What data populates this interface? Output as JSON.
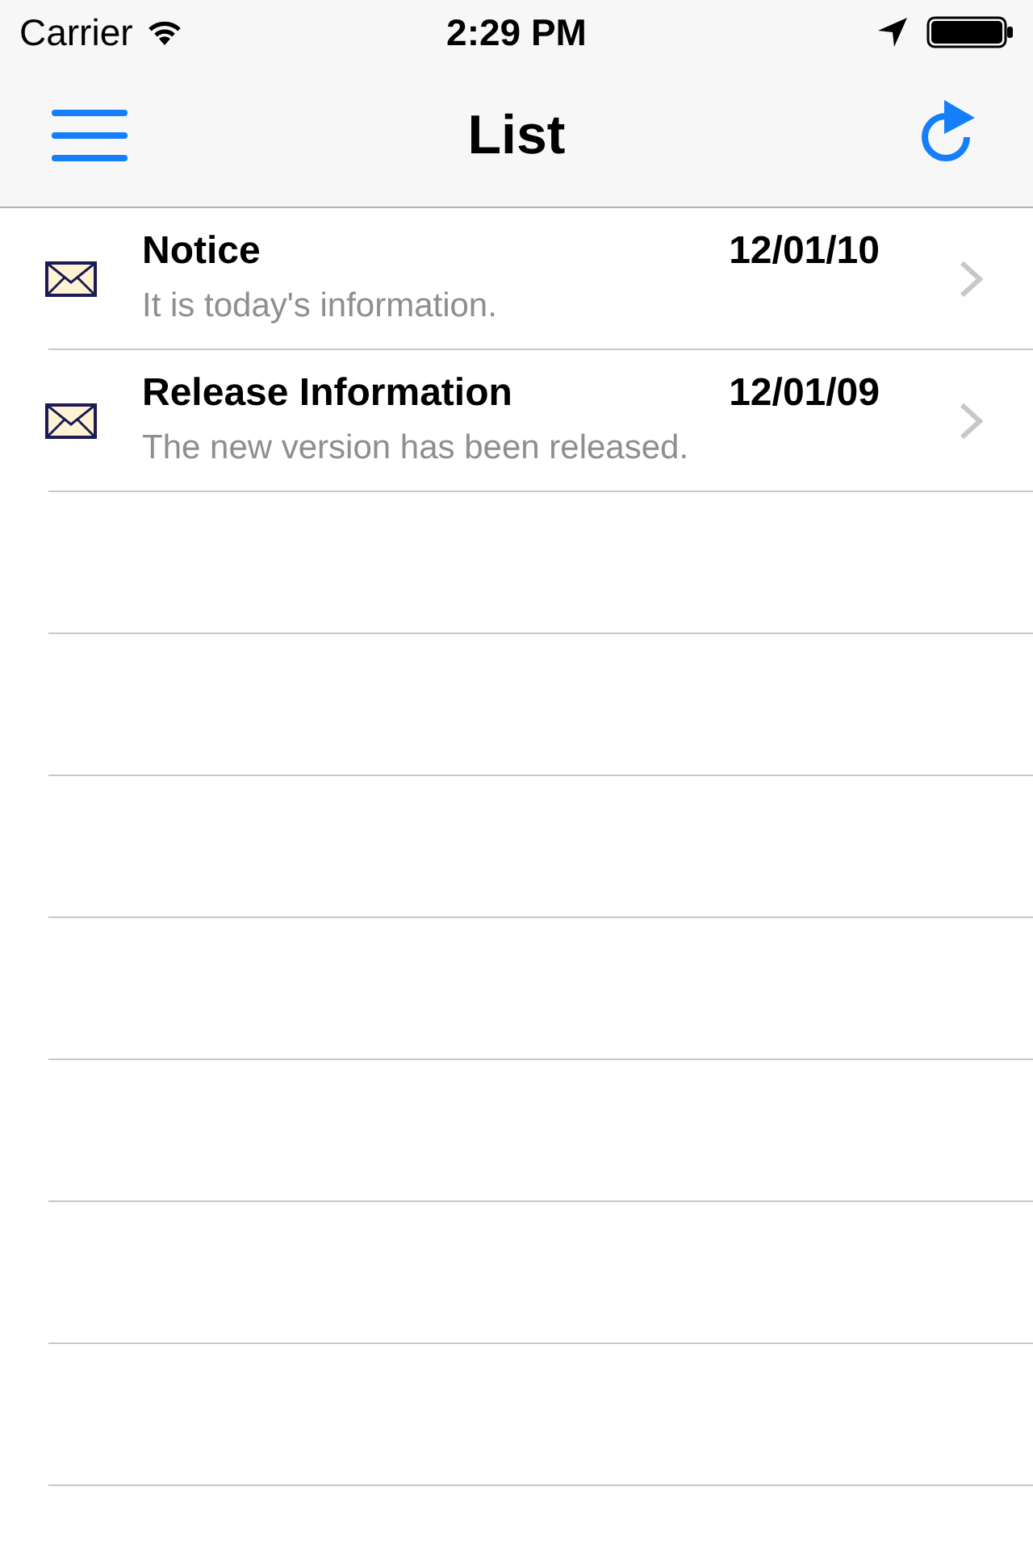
{
  "status_bar": {
    "carrier": "Carrier",
    "time": "2:29 PM"
  },
  "nav_bar": {
    "title": "List"
  },
  "rows": [
    {
      "title": "Notice",
      "date": "12/01/10",
      "subtitle": "It is today's information."
    },
    {
      "title": "Release Information",
      "date": "12/01/09",
      "subtitle": "The new version has been released."
    }
  ]
}
